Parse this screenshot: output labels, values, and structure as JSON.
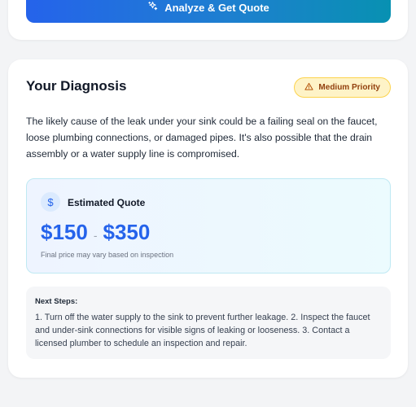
{
  "top_card": {
    "analyze_button_label": "Analyze & Get Quote",
    "analyze_icon": "sparkles-icon"
  },
  "diagnosis": {
    "title": "Your Diagnosis",
    "priority": {
      "label": "Medium Priority",
      "icon": "warning-triangle-icon",
      "color": "#92400e",
      "background": "#fef3c7"
    },
    "text": "The likely cause of the leak under your sink could be a failing seal on the faucet, loose plumbing connections, or damaged pipes. It's also possible that the drain assembly or a water supply line is compromised.",
    "quote": {
      "icon": "dollar-icon",
      "label": "Estimated Quote",
      "min": "$150",
      "separator": "-",
      "max": "$350",
      "note": "Final price may vary based on inspection",
      "accent": "#2563eb"
    },
    "next_steps": {
      "title": "Next Steps:",
      "text": "1. Turn off the water supply to the sink to prevent further leakage. 2. Inspect the faucet and under-sink connections for visible signs of leaking or looseness. 3. Contact a licensed plumber to schedule an inspection and repair."
    }
  }
}
